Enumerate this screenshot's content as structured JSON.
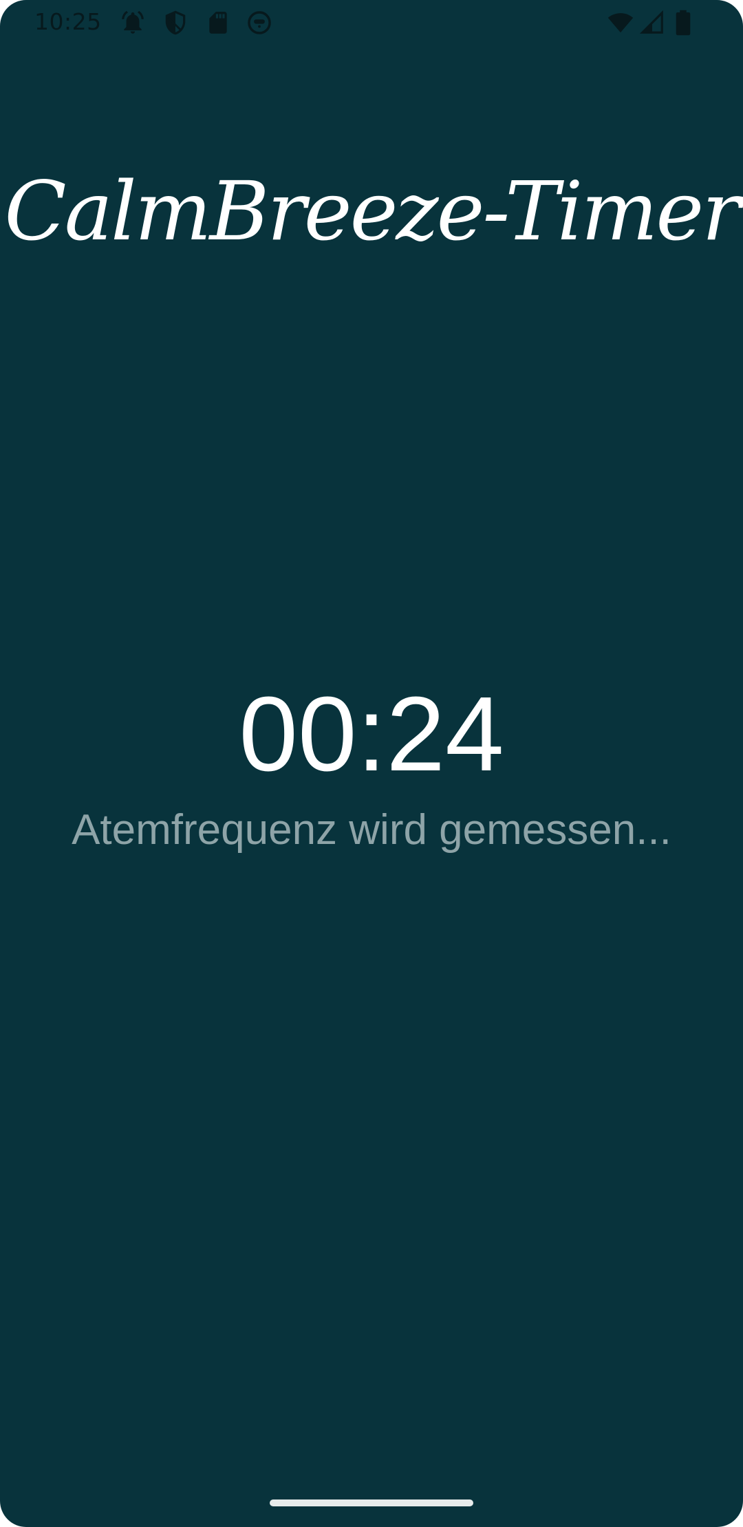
{
  "status_bar": {
    "time": "10:25",
    "icons_left": [
      "alarm-icon",
      "shield-icon",
      "sd-card-icon",
      "face-icon"
    ],
    "icons_right": [
      "wifi-icon",
      "cell-signal-icon",
      "battery-icon"
    ]
  },
  "app": {
    "title": "CalmBreeze-Timer",
    "timer": "00:24",
    "status_text": "Atemfrequenz wird gemessen..."
  },
  "colors": {
    "background": "#08333c",
    "primary_text": "#ffffff",
    "secondary_text": "#8ea4a8",
    "status_icons": "#07191d"
  }
}
